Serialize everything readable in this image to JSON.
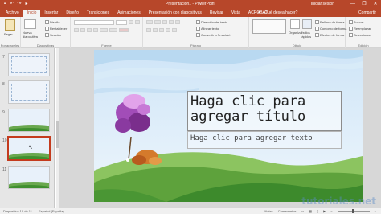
{
  "titlebar": {
    "title": "Presentación1 - PowerPoint",
    "user": "Iniciar sesión",
    "qat": [
      "save-icon",
      "undo-icon",
      "redo-icon",
      "present-icon"
    ],
    "controls": [
      "—",
      "❐",
      "✕"
    ]
  },
  "tabs": [
    {
      "label": "Archivo"
    },
    {
      "label": "Inicio",
      "active": true
    },
    {
      "label": "Insertar"
    },
    {
      "label": "Diseño"
    },
    {
      "label": "Transiciones"
    },
    {
      "label": "Animaciones"
    },
    {
      "label": "Presentación con diapositivas"
    },
    {
      "label": "Revisar"
    },
    {
      "label": "Vista"
    },
    {
      "label": "ACROBAT"
    }
  ],
  "tellme": "¿Qué desea hacer?",
  "share": "Compartir",
  "ribbon": {
    "clipboard": {
      "paste": "Pegar",
      "label": "Portapapeles"
    },
    "slides": {
      "new": "Nueva diapositiva",
      "layout": "Diseño",
      "reset": "Restablecer",
      "section": "Sección",
      "label": "Diapositivas"
    },
    "font": {
      "label": "Fuente"
    },
    "paragraph": {
      "direction": "Dirección del texto",
      "align": "Alinear texto",
      "smartart": "Convertir a SmartArt",
      "label": "Párrafo"
    },
    "drawing": {
      "arrange": "Organizar",
      "quick": "Estilos rápidos",
      "fill": "Relleno de forma",
      "outline": "Contorno de forma",
      "effects": "Efectos de forma",
      "label": "Dibujo"
    },
    "editing": {
      "find": "Buscar",
      "replace": "Reemplazar",
      "select": "Seleccionar",
      "label": "Edición"
    }
  },
  "thumbnails": [
    {
      "num": "7"
    },
    {
      "num": "8"
    },
    {
      "num": "9"
    },
    {
      "num": "10",
      "selected": true
    },
    {
      "num": "11"
    }
  ],
  "slide": {
    "title_placeholder": "Haga clic para agregar título",
    "subtitle_placeholder": "Haga clic para agregar texto"
  },
  "statusbar": {
    "slide_count": "Diapositiva 10 de 11",
    "language": "Español (España)",
    "notes": "Notas",
    "comments": "Comentarios",
    "zoom": "+"
  },
  "watermark": "tutoriales.net",
  "colors": {
    "accent": "#b7472a",
    "ribbon_bg": "#f3f3f3",
    "grass": "#4f9a3a",
    "tree_canopy": "#a24db8"
  }
}
